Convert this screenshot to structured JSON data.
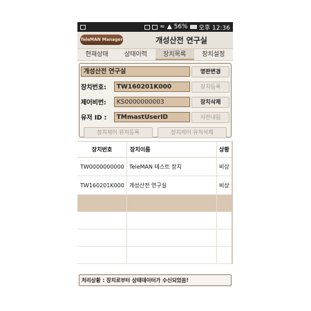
{
  "status_bar": {
    "battery": "56%",
    "time": "오후 12:36"
  },
  "header": {
    "logo": "TeleMAN Manager",
    "title": "개성산전 연구실"
  },
  "tabs": [
    {
      "label": "현재상태",
      "active": false
    },
    {
      "label": "상태이력",
      "active": false
    },
    {
      "label": "장치목록",
      "active": true
    },
    {
      "label": "장치설정",
      "active": false
    }
  ],
  "form": {
    "name_value": "개성산전 연구실",
    "rename_button": "명판변경",
    "device_no_label": "장치번호:",
    "device_no_value": "TW160201K000",
    "register_button": "장치등록",
    "control_no_label": "제어비번:",
    "control_no_value": "KS0000000003",
    "delete_button": "장치삭제",
    "user_id_label": "유저 ID :",
    "user_id_value": "TMmastUserID",
    "self_button": "자판내림",
    "register_user_button": "장치제어 유저등록",
    "delete_user_button": "장치제어 유저삭제"
  },
  "table": {
    "headers": [
      "장치번호",
      "장치이름",
      "상황"
    ],
    "rows": [
      {
        "no": "TW0000000000",
        "name": "TeleMAN 테스트 장치",
        "state": "비상"
      },
      {
        "no": "TW160201K000",
        "name": "개성산전 연구실",
        "state": "비상"
      }
    ]
  },
  "footer": {
    "status_text": "처리상황 : 장치로부터 상태데이터가 수신되었음!"
  }
}
